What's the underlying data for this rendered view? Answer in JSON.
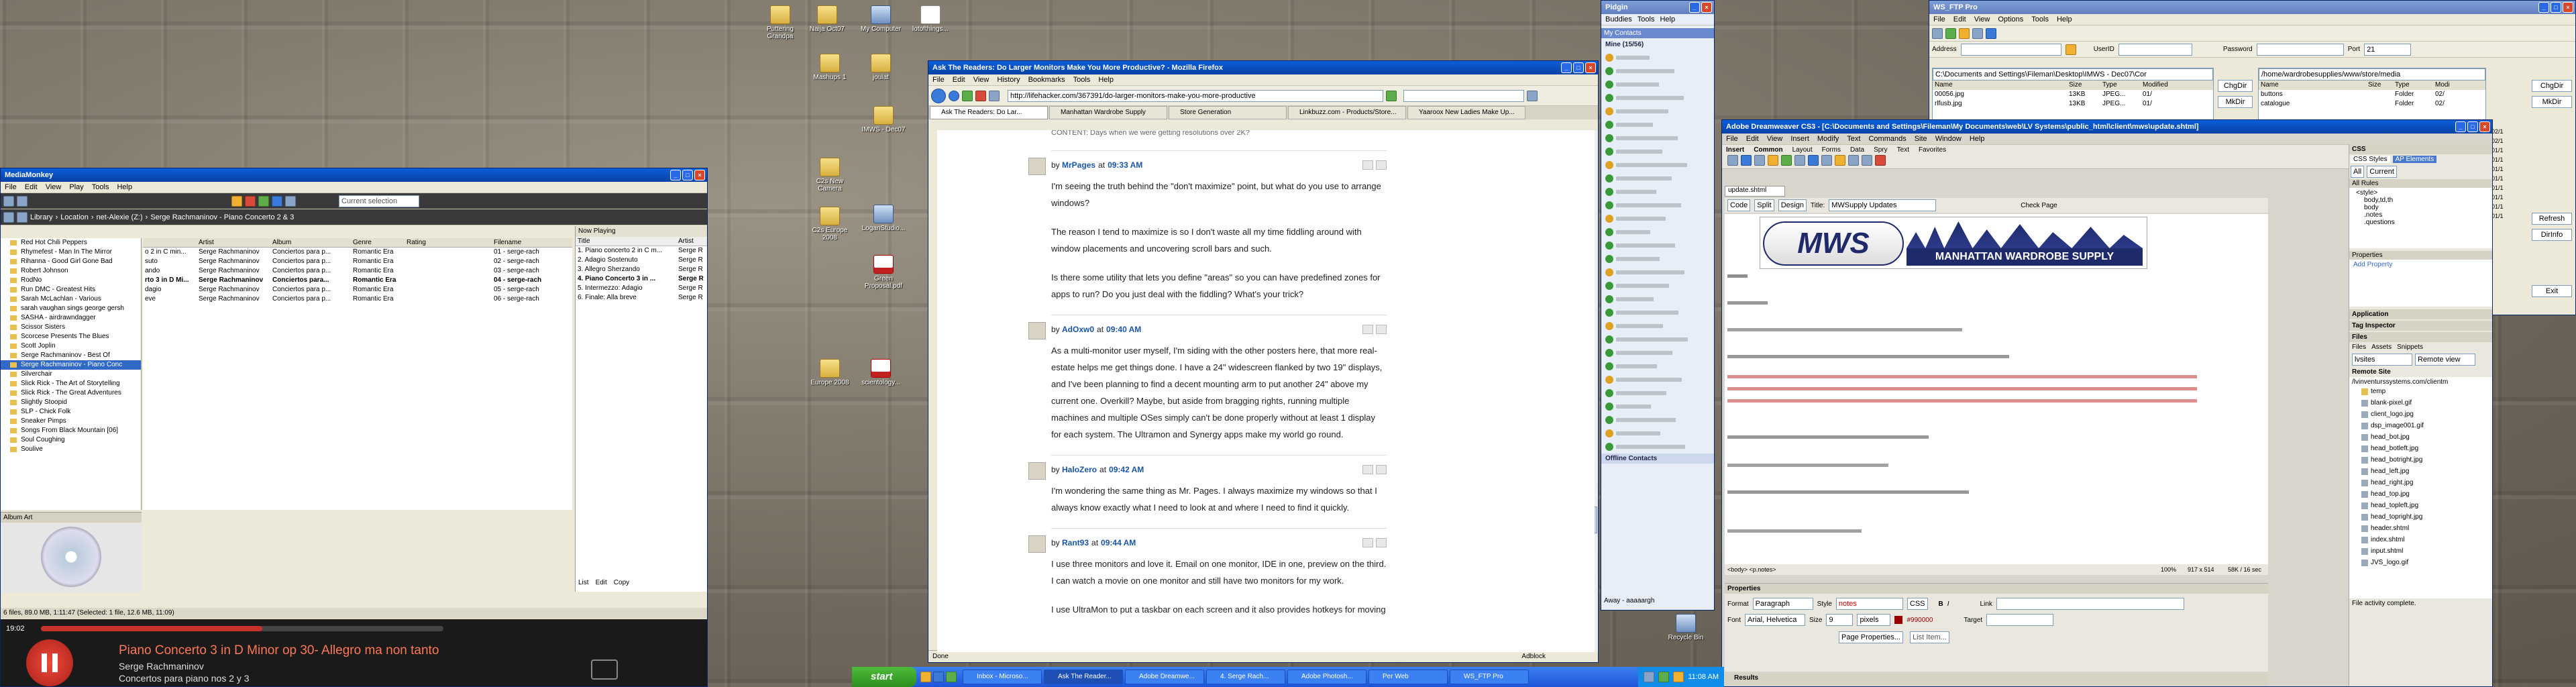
{
  "desktop_icons": [
    {
      "label": "Puttering Grandpa"
    },
    {
      "label": "Naija Oct07"
    },
    {
      "label": "My Computer"
    },
    {
      "label": "lotofthings..."
    },
    {
      "label": "Mashups 1"
    },
    {
      "label": "jouiat"
    },
    {
      "label": "IMWS - Dec07"
    },
    {
      "label": "C2s New Camera"
    },
    {
      "label": "C2s Europe 2008"
    },
    {
      "label": "LoganStudio..."
    },
    {
      "label": "Green Proposal.pdf"
    },
    {
      "label": "Europe 2008"
    },
    {
      "label": "scientology..."
    },
    {
      "label": "Recycle Bin"
    }
  ],
  "mediamonkey": {
    "title": "MediaMonkey",
    "menu": [
      "File",
      "Edit",
      "View",
      "Play",
      "Tools",
      "Help"
    ],
    "breadcrumb": [
      "Library",
      "Location",
      "net-Alexie (Z:)",
      "Serge Rachmaninov - Piano Concerto 2 & 3"
    ],
    "search_placeholder": "Current selection",
    "artists": [
      "Red Hot Chili Peppers",
      "Rhymefest - Man In The Mirror",
      "Rihanna - Good Girl Gone Bad",
      "Robert Johnson",
      "RodNo",
      "Run DMC - Greatest Hits",
      "Sarah McLachlan - Various",
      "sarah vaughan sings george gersh",
      "SASHA - airdrawndagger",
      "Scissor Sisters",
      "Scorcese Presents The Blues",
      "Scott Joplin",
      "Serge Rachmaninov - Best Of",
      "Serge Rachmaninov - Piano Conc",
      "Silverchair",
      "Slick Rick - The Art of Storytelling",
      "Slick Rick - The Great Adventures",
      "Slightly Stoopid",
      "SLP - Chick Folk",
      "Sneaker Pimps",
      "Songs From Black Mountain [06]",
      "Soul Coughing",
      "Soulive"
    ],
    "columns": [
      "Artist",
      "Album",
      "Genre",
      "Rating",
      "Filename"
    ],
    "tracks": [
      {
        "title": "o 2 in C min...",
        "artist": "Serge Rachmaninov",
        "album": "Conciertos para p...",
        "genre": "Romantic Era",
        "filename": "01 - serge-rach"
      },
      {
        "title": "suto",
        "artist": "Serge Rachmaninov",
        "album": "Conciertos para p...",
        "genre": "Romantic Era",
        "filename": "02 - serge-rach"
      },
      {
        "title": "ando",
        "artist": "Serge Rachmaninov",
        "album": "Conciertos para p...",
        "genre": "Romantic Era",
        "filename": "03 - serge-rach"
      },
      {
        "title": "rto 3 in D Mi...",
        "artist": "Serge Rachmaninov",
        "album": "Conciertos para...",
        "genre": "Romantic Era",
        "filename": "04 - serge-rach"
      },
      {
        "title": "dagio",
        "artist": "Serge Rachmaninov",
        "album": "Conciertos para p...",
        "genre": "Romantic Era",
        "filename": "05 - serge-rach"
      },
      {
        "title": "eve",
        "artist": "Serge Rachmaninov",
        "album": "Conciertos para p...",
        "genre": "Romantic Era",
        "filename": "06 - serge-rach"
      }
    ],
    "now_playing_header": [
      "Title",
      "Artist"
    ],
    "now_playing": [
      {
        "title": "1. Piano concerto 2 in C m...",
        "artist": "Serge R"
      },
      {
        "title": "2. Adagio Sostenuto",
        "artist": "Serge R"
      },
      {
        "title": "3. Allegro Sherzando",
        "artist": "Serge R"
      },
      {
        "title": "4. Piano Concerto 3 in ...",
        "artist": "Serge R"
      },
      {
        "title": "5. Intermezzo: Adagio",
        "artist": "Serge R"
      },
      {
        "title": "6. Finale: Alla breve",
        "artist": "Serge R"
      }
    ],
    "now_playing_tab": "Now Playing",
    "album_art_label": "Album Art",
    "list_menu": [
      "List",
      "Edit",
      "Copy"
    ],
    "status": "6 files, 89.0 MB, 1:11:47 (Selected: 1 file, 12.6 MB, 11:09)",
    "player_time": "19:02",
    "player_title": "Piano Concerto 3 in D Minor op 30- Allegro ma non tanto",
    "player_artist": "Serge Rachmaninov",
    "player_album": "Concertos para piano nos 2 y 3",
    "progress": 0.55
  },
  "firefox": {
    "title": "Ask The Readers: Do Larger Monitors Make You More Productive? - Mozilla Firefox",
    "menu": [
      "File",
      "Edit",
      "View",
      "History",
      "Bookmarks",
      "Tools",
      "Help"
    ],
    "url": "http://lifehacker.com/367391/do-larger-monitors-make-you-more-productive",
    "tabs": [
      "Ask The Readers: Do Lar...",
      "Manhattan Wardrobe Supply",
      "Store Generation",
      "Linkbuzz.com - Products/Store...",
      "Yaaroox New Ladies Make Up..."
    ],
    "top_text": "CONTENT: Days when we were getting resolutions over 2K?",
    "comments": [
      {
        "author": "MrPages",
        "at": "at",
        "time": "09:33 AM",
        "paragraphs": [
          "I'm seeing the truth behind the \"don't maximize\" point, but what do you use to arrange windows?",
          "The reason I tend to maximize is so I don't waste all my time fiddling around with window placements and uncovering scroll bars and such.",
          "Is there some utility that lets you define \"areas\" so you can have predefined zones for apps to run? Do you just deal with the fiddling? What's your trick?"
        ]
      },
      {
        "author": "AdOxw0",
        "at": "at",
        "time": "09:40 AM",
        "paragraphs": [
          "As a multi-monitor user myself, I'm siding with the other posters here, that more real-estate helps me get things done. I have a 24\" widescreen flanked by two 19\" displays, and I've been planning to find a decent mounting arm to put another 24\" above my current one. Overkill? Maybe, but aside from bragging rights, running multiple machines and multiple OSes simply can't be done properly without at least 1 display for each system. The Ultramon and Synergy apps make my world go round."
        ]
      },
      {
        "author": "HaloZero",
        "at": "at",
        "time": "09:42 AM",
        "paragraphs": [
          "I'm wondering the same thing as Mr. Pages. I always maximize my windows so that I always know exactly what I need to look at and where I need to find it quickly."
        ]
      },
      {
        "author": "Rant93",
        "at": "at",
        "time": "09:44 AM",
        "paragraphs": [
          "I use three monitors and love it. Email on one monitor, IDE in one, preview on the third. I can watch a movie on one monitor and still have two monitors for my work.",
          "I use UltraMon to put a taskbar on each screen and it also provides hotkeys for moving"
        ]
      }
    ],
    "status": "Done",
    "adblock": "Adblock"
  },
  "messenger": {
    "title": "Pidgin",
    "menu": [
      "Buddies",
      "Tools",
      "Help"
    ],
    "section": "My Contacts",
    "online": "Mine (15/56)",
    "offline": "Offline Contacts",
    "status": "Away - aaaaargh"
  },
  "ftp": {
    "title": "WS_FTP Pro",
    "menu": [
      "File",
      "Edit",
      "View",
      "Options",
      "Tools",
      "Help"
    ],
    "address_label": "Address",
    "user_label": "UserID",
    "password_label": "Password",
    "port_label": "Port",
    "port": "21",
    "local_path": "C:\\Documents and Settings\\Fileman\\Desktop\\IMWS - Dec07\\Cor",
    "remote_path": "/home/wardrobesupplies/www/store/media",
    "local_cols": [
      "Name",
      "Size",
      "Type",
      "Modified"
    ],
    "local_files": [
      [
        "00056.jpg",
        "13KB",
        "JPEG...",
        "01/"
      ],
      [
        "rlfusb.jpg",
        "13KB",
        "JPEG...",
        "01/"
      ]
    ],
    "remote_cols": [
      "Name",
      "Size",
      "Type",
      "Modi"
    ],
    "remote_files": [
      [
        "buttons",
        "",
        "Folder",
        "02/"
      ],
      [
        "catalogue",
        "",
        "Folder",
        "02/"
      ]
    ],
    "side_buttons": [
      "ChgDir",
      "MkDir",
      "ChgDir",
      "MkDir"
    ],
    "right_buttons": [
      "Refresh",
      "DirInfo"
    ],
    "exit": "Exit",
    "remote_dates": [
      "02/1",
      "02/1",
      "01/1",
      "01/1",
      "01/1",
      "01/1",
      "01/1",
      "01/1",
      "01/1",
      "01/1"
    ]
  },
  "dreamweaver": {
    "title": "Adobe Dreamweaver CS3 - [C:\\Documents and Settings\\Fileman\\My Documents\\web\\LV Systems\\public_html\\client\\mws\\update.shtml]",
    "menu": [
      "File",
      "Edit",
      "View",
      "Insert",
      "Modify",
      "Text",
      "Commands",
      "Site",
      "Window",
      "Help"
    ],
    "insert_tabs": [
      "Common",
      "Layout",
      "Forms",
      "Data",
      "Spry",
      "Text",
      "Favorites"
    ],
    "insert_label": "Insert",
    "doc_tab": "update.shtml",
    "view_buttons": [
      "Code",
      "Split",
      "Design"
    ],
    "title_label": "Title:",
    "doc_title": "MWSupply Updates",
    "check_page": "Check Page",
    "logo_text": "MWS",
    "logo_sub": "MANHATTAN WARDROBE SUPPLY",
    "tag_path": "<body> <p.notes>",
    "zoom": "100%",
    "size_info": "917 x 514",
    "download": "58K / 16 sec",
    "properties_label": "Properties",
    "format_label": "Format",
    "format_value": "Paragraph",
    "style_label": "Style",
    "style_value": "notes",
    "css_button": "CSS",
    "font_label": "Font",
    "font_value": "Arial, Helvetica",
    "size_label": "Size",
    "size_value": "9",
    "unit_value": "pixels",
    "color_value": "#990000",
    "link_label": "Link",
    "target_label": "Target",
    "page_props": "Page Properties...",
    "list_item": "List Item...",
    "results": "Results",
    "css_panel": "CSS",
    "css_tabs": [
      "CSS Styles",
      "AP Elements"
    ],
    "css_subtabs": [
      "All",
      "Current"
    ],
    "all_rules": "All Rules",
    "rules": [
      "<style>",
      "body,td,th",
      "body",
      ".notes",
      ".questions"
    ],
    "props_label": "Properties",
    "add_property": "Add Property",
    "application": "Application",
    "tag_inspector": "Tag Inspector",
    "files_label": "Files",
    "files_tabs": [
      "Files",
      "Assets",
      "Snippets"
    ],
    "site_select": "lvsites",
    "view_select": "Remote view",
    "remote_site": "Remote Site",
    "remote_root": "/lvinventurssystems.com/clientm",
    "remote_files": [
      "temp",
      "blank-pixel.gif",
      "client_logo.jpg",
      "dsp_image001.gif",
      "head_bot.jpg",
      "head_botleft.jpg",
      "head_botright.jpg",
      "head_left.jpg",
      "head_right.jpg",
      "head_top.jpg",
      "head_topleft.jpg",
      "head_topright.jpg",
      "header.shtml",
      "index.shtml",
      "input.shtml",
      "JVS_logo.gif"
    ],
    "activity": "File activity complete."
  },
  "taskbar": {
    "start": "start",
    "tasks": [
      "Inbox - Microso...",
      "Ask The Reader...",
      "Adobe Dreamwe...",
      "4. Serge Rach...",
      "Adobe Photosh...",
      "Per Web",
      "WS_FTP Pro"
    ],
    "clock": "11:08 AM"
  }
}
